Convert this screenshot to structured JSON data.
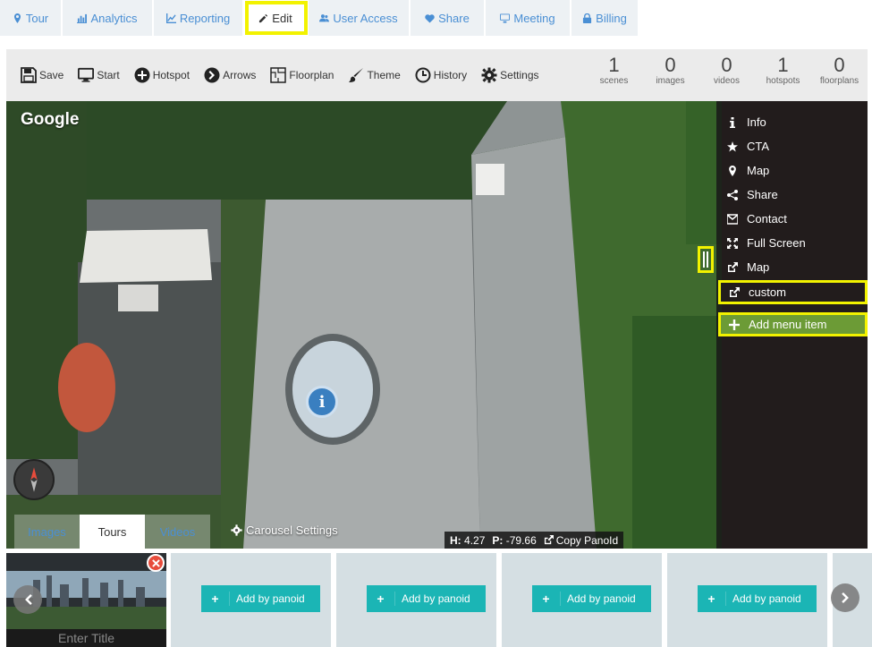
{
  "nav_tabs": [
    {
      "label": "Tour",
      "icon": "map-marker-icon"
    },
    {
      "label": "Analytics",
      "icon": "bar-chart-icon"
    },
    {
      "label": "Reporting",
      "icon": "line-chart-icon"
    },
    {
      "label": "Edit",
      "icon": "pencil-icon"
    },
    {
      "label": "User Access",
      "icon": "users-icon"
    },
    {
      "label": "Share",
      "icon": "heart-icon"
    },
    {
      "label": "Meeting",
      "icon": "monitor-icon"
    },
    {
      "label": "Billing",
      "icon": "lock-icon"
    }
  ],
  "toolbar": {
    "save": "Save",
    "start": "Start",
    "hotspot": "Hotspot",
    "arrows": "Arrows",
    "floorplan": "Floorplan",
    "theme": "Theme",
    "history": "History",
    "settings": "Settings"
  },
  "stats": [
    {
      "num": "1",
      "label": "scenes"
    },
    {
      "num": "0",
      "label": "images"
    },
    {
      "num": "0",
      "label": "videos"
    },
    {
      "num": "1",
      "label": "hotspots"
    },
    {
      "num": "0",
      "label": "floorplans"
    }
  ],
  "viewer": {
    "brand": "Google",
    "menu": [
      {
        "label": "Info",
        "icon": "info-icon"
      },
      {
        "label": "CTA",
        "icon": "star-icon"
      },
      {
        "label": "Map",
        "icon": "map-marker-icon"
      },
      {
        "label": "Share",
        "icon": "share-icon"
      },
      {
        "label": "Contact",
        "icon": "envelope-icon"
      },
      {
        "label": "Full Screen",
        "icon": "expand-icon"
      },
      {
        "label": "Map",
        "icon": "external-link-icon"
      },
      {
        "label": "custom",
        "icon": "external-link-icon"
      },
      {
        "label": "Add menu item",
        "icon": "plus-icon"
      }
    ],
    "bottom_tabs": [
      "Images",
      "Tours",
      "Videos"
    ],
    "carousel_settings": "Carousel Settings",
    "heading_label": "H:",
    "heading_value": "4.27",
    "pitch_label": "P:",
    "pitch_value": "-79.66",
    "copy_panoid": "Copy PanoId"
  },
  "carousel": {
    "thumb_title": "Enter Title",
    "add_label": "Add by panoid"
  },
  "colors": {
    "highlight": "#f2f200",
    "link": "#4a8fd4",
    "teal": "#1bb5b5",
    "green": "#6c9b36"
  }
}
